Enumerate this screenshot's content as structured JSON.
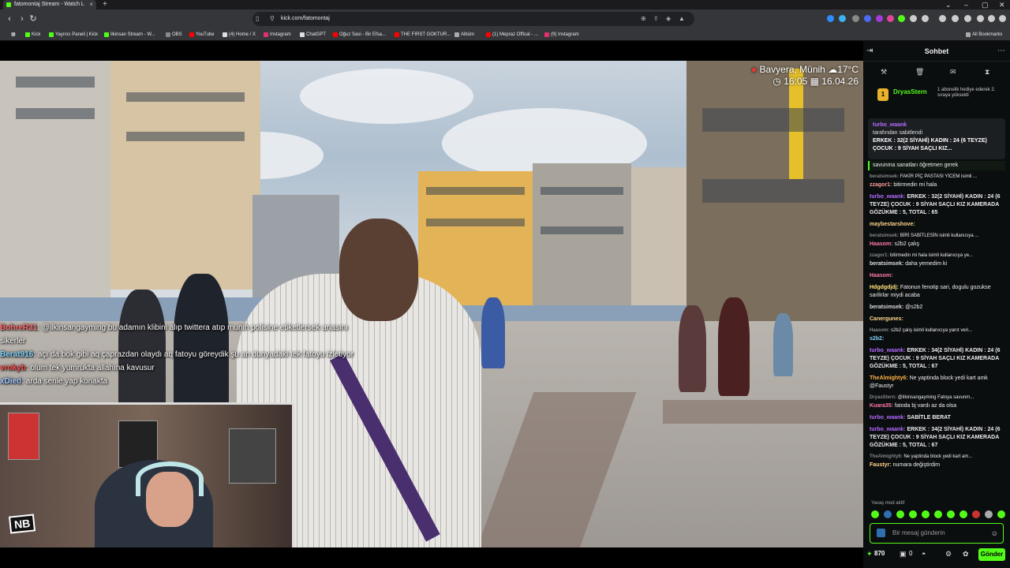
{
  "browser": {
    "tab_title": "fatomontaj Stream - Watch L",
    "new_tab": "+",
    "url": "kick.com/fatomontaj",
    "bookmarks": [
      "Kick",
      "Yayıncı Paneli | Kick",
      "ilkinsan Stream - W...",
      "OBS",
      "YouTube",
      "(4) Home / X",
      "Instagram",
      "ChatGPT",
      "Oğuz Sasi - Bir Efsa...",
      "THE FIRST GOKTUR...",
      "Albüm",
      "(1) Mepraz Offical - ...",
      "(9) Instagram"
    ],
    "all_bookmarks": "All Bookmarks"
  },
  "overlay": {
    "location": "Bavyera, Münih",
    "temp": "17°C",
    "time": "16:05",
    "date": "16.04.26"
  },
  "stream_chat": [
    {
      "user": "BohreR31",
      "user_color": "#ff6b6b",
      "text": "@ilkinsangayming bu adamın klibini alıp twittera atıp munih polisine etiketlersek anasını sikerler"
    },
    {
      "user": "Berat916",
      "user_color": "#7dd3fc",
      "text": "açı da bok gibi aq çaprazdan olaydı aq fatoyu göreydik şu an dunyadaki tek fatoyu izletiyor"
    },
    {
      "user": "vrokyb",
      "user_color": "#ff4d4d",
      "text": "olum tek yumrukta allahına kavusur"
    },
    {
      "user": "xDied",
      "user_color": "#9ec5ff",
      "text": "arda senle yap konakta"
    }
  ],
  "cam": {
    "logo": "NB"
  },
  "chat": {
    "title": "Sohbet",
    "gifter": {
      "name": "DryasStern",
      "desc": "1 abonelik hediye ederek 2. sıraya yükseldi",
      "rank": "1"
    },
    "pinned": {
      "user": "turbo_waank",
      "by": "tarafından sabitlendi",
      "text": "ERKEK : 32(2 SİYAHİ) KADIN : 24 (6 TEYZE) ÇOCUK : 9 SİYAH SAÇLI KIZ..."
    },
    "messages": [
      {
        "user": "",
        "color": "#aaa",
        "text": "savunma sanatları öğretmen gerek",
        "cls": "hl"
      },
      {
        "user": "beratsimsek:",
        "color": "#888",
        "text": "FAKİR PİÇ PASTASI YİCEM isimli ...",
        "cls": "reply"
      },
      {
        "user": "zzagor1:",
        "color": "#ff9b9b",
        "text": "bitirmedin mi hala",
        "cls": ""
      },
      {
        "user": "turbo_waank:",
        "color": "#b46bff",
        "text": "ERKEK : 32(2 SİYAHİ) KADIN : 24 (6 TEYZE) ÇOCUK : 9 SİYAH SAÇLI KIZ KAMERADA GÖZÜKME : 5, TOTAL : 65",
        "cls": "bold"
      },
      {
        "user": "maybestarshove:",
        "color": "#ffd58a",
        "text": "",
        "cls": ""
      },
      {
        "user": "beratsimsek:",
        "color": "#888",
        "text": "BİRİ SABİTLESİN isimli kullanıcıya ...",
        "cls": "reply"
      },
      {
        "user": "Haasom:",
        "color": "#ff7aa8",
        "text": "s2b2 çalış",
        "cls": ""
      },
      {
        "user": "zzagor1:",
        "color": "#888",
        "text": "bitirmedin mi hala isimli kullanıcıya ye...",
        "cls": "reply"
      },
      {
        "user": "beratsimsek:",
        "color": "#ddd",
        "text": "daha yemedim ki",
        "cls": ""
      },
      {
        "user": "Haasom:",
        "color": "#ff7aa8",
        "text": "",
        "cls": ""
      },
      {
        "user": "Hdgdgdjdj:",
        "color": "#ffe27a",
        "text": "Fatonun fenotip sari, dogulu gozukse sarilirlar miydi acaba",
        "cls": ""
      },
      {
        "user": "beratsimsek:",
        "color": "#ddd",
        "text": "@s2b2",
        "cls": ""
      },
      {
        "user": "Canergunes:",
        "color": "#ffd58a",
        "text": "",
        "cls": ""
      },
      {
        "user": "Haasom:",
        "color": "#888",
        "text": "s2b2 çalış isimli kullanıcıya yanıt veri...",
        "cls": "reply"
      },
      {
        "user": "s2b2:",
        "color": "#7dd3fc",
        "text": "",
        "cls": ""
      },
      {
        "user": "turbo_waank:",
        "color": "#b46bff",
        "text": "ERKEK : 34(2 SİYAHİ) KADIN : 24 (6 TEYZE) ÇOCUK : 9 SİYAH SAÇLI KIZ KAMERADA GÖZÜKME : 5, TOTAL : 67",
        "cls": "bold"
      },
      {
        "user": "TheAlmighty6:",
        "color": "#ffb347",
        "text": "Ne yaptinda block yedi kart amk @Faustyr",
        "cls": ""
      },
      {
        "user": "DryasStern:",
        "color": "#888",
        "text": "@ilkinsangayming Fatoya savunm...",
        "cls": "reply"
      },
      {
        "user": "Kuara35:",
        "color": "#ff7aa8",
        "text": "fatoda bj vardı az da olsa",
        "cls": ""
      },
      {
        "user": "turbo_waank:",
        "color": "#b46bff",
        "text": "SABİTLE BERAT",
        "cls": "bold"
      },
      {
        "user": "turbo_waank:",
        "color": "#b46bff",
        "text": "ERKEK : 34(2 SİYAHİ) KADIN : 24 (6 TEYZE) ÇOCUK : 9 SİYAH SAÇLI KIZ KAMERADA GÖZÜKME : 5, TOTAL : 67",
        "cls": "bold"
      },
      {
        "user": "TheAlmighty6:",
        "color": "#888",
        "text": "Ne yaptinda block yedi kart am...",
        "cls": "reply"
      },
      {
        "user": "Faustyr:",
        "color": "#ffd58a",
        "text": "numara değiştirdim",
        "cls": ""
      }
    ],
    "slow_mode": "Yavaş mod aktif",
    "input_placeholder": "Bir mesaj gönderin",
    "points": "870",
    "count": "0",
    "send": "Gönder"
  }
}
